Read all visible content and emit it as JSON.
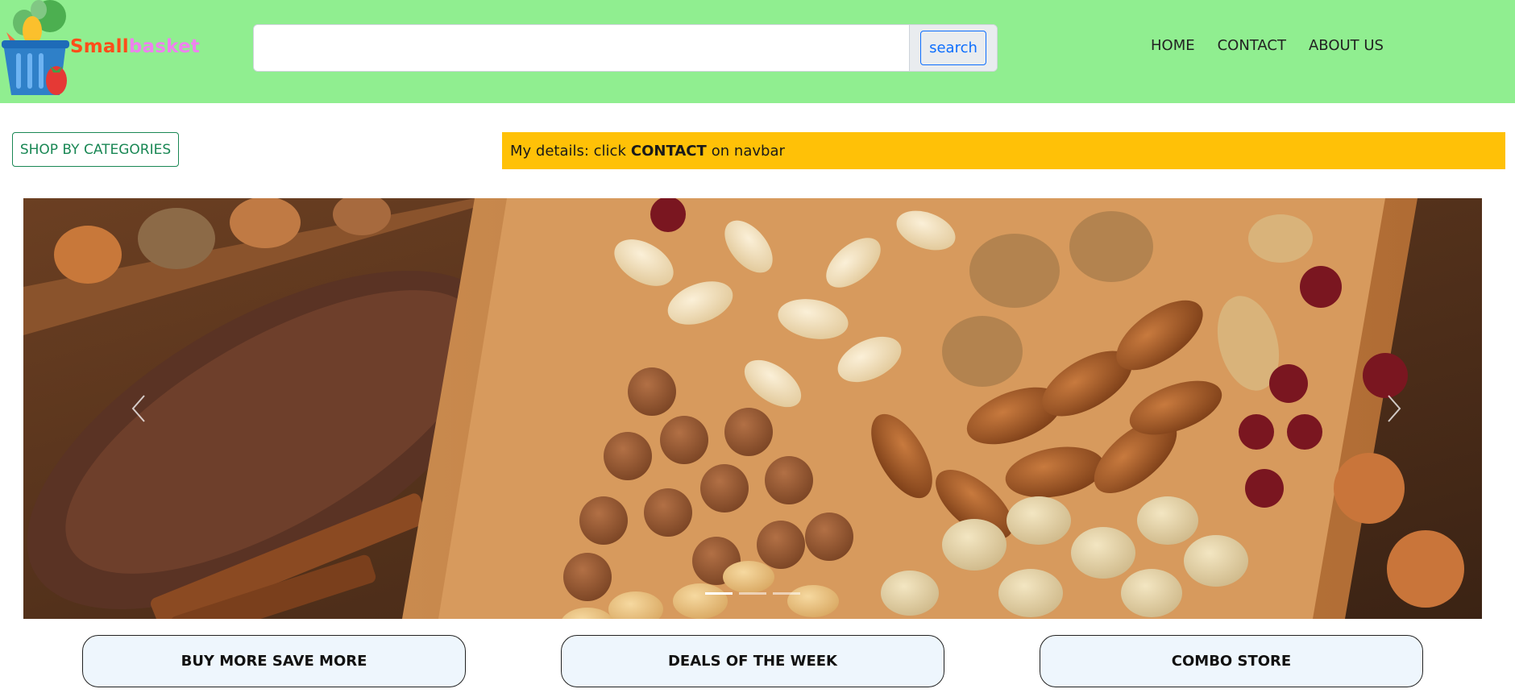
{
  "brand": {
    "part1": "Small",
    "part2": "basket"
  },
  "search": {
    "placeholder": "",
    "value": "",
    "button_label": "search"
  },
  "nav": {
    "links": [
      "HOME",
      "CONTACT",
      "ABOUT US"
    ]
  },
  "shop_button": "SHOP BY CATEGORIES",
  "alert": {
    "prefix": "My details: click",
    "emphasis": "CONTACT",
    "suffix": "on navbar"
  },
  "carousel": {
    "slide_count": 3,
    "active_index": 0,
    "image_subject": "assorted nuts on wooden tray"
  },
  "categories": [
    "BUY MORE SAVE MORE",
    "DEALS OF THE WEEK",
    "COMBO STORE"
  ],
  "colors": {
    "navbar": "#90ee90",
    "brand_small": "#ff4d1a",
    "brand_basket": "#ee82ee",
    "alert": "#ffc107",
    "category_bg": "#eef6fd"
  }
}
